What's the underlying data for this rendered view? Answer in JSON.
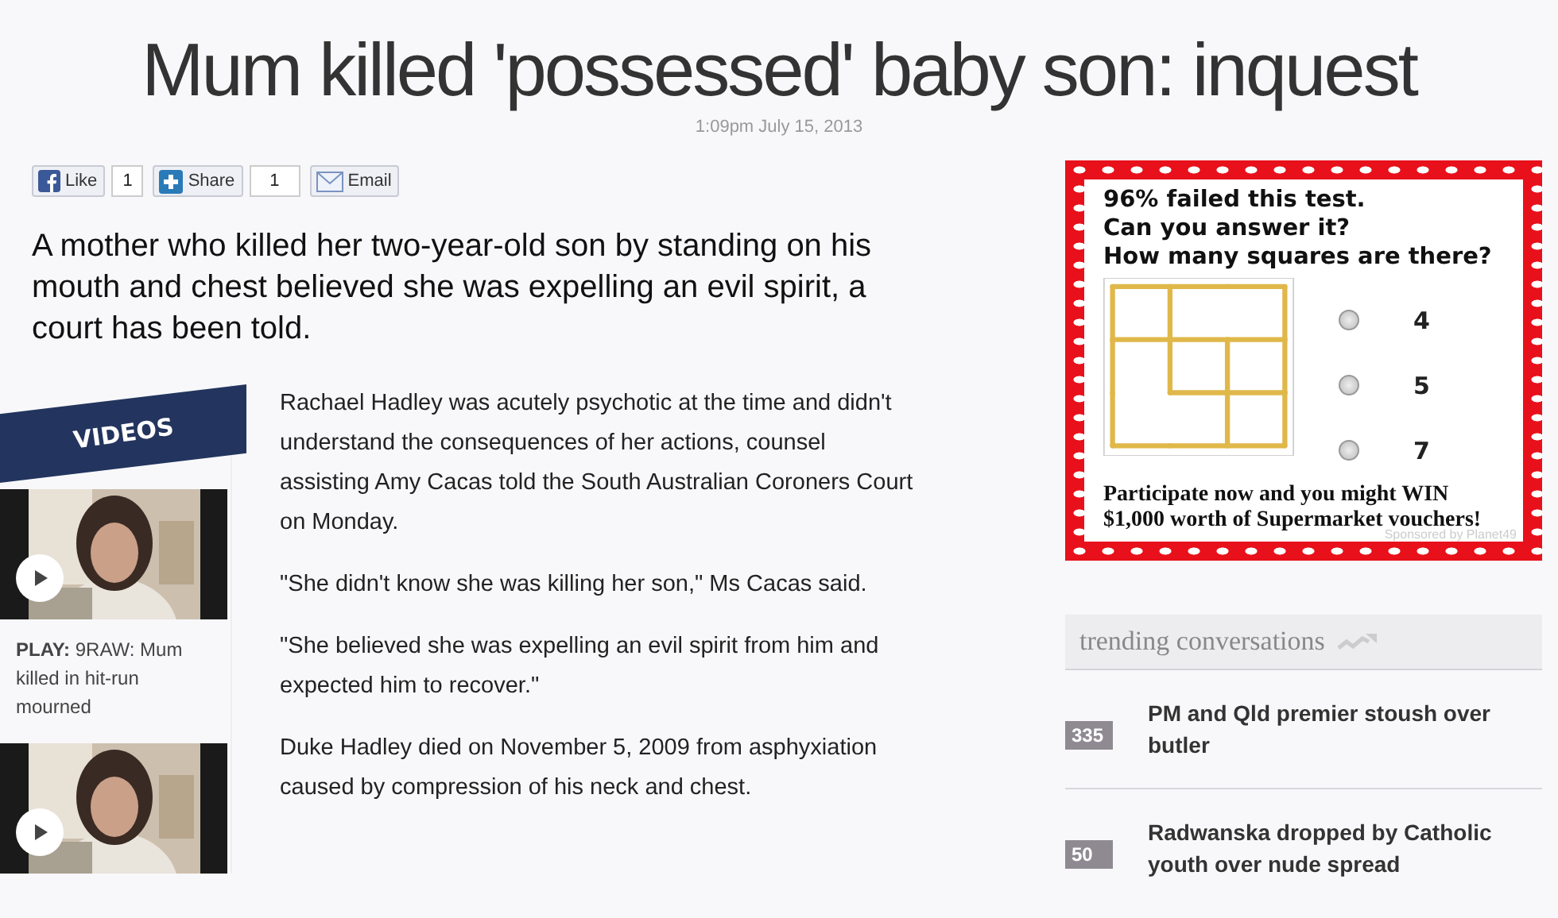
{
  "headline": "Mum killed 'possessed' baby son: inquest",
  "timestamp": "1:09pm July 15, 2013",
  "share_bar": {
    "like": {
      "label": "Like",
      "count": "1"
    },
    "share": {
      "label": "Share",
      "count": "1"
    },
    "email": {
      "label": "Email"
    }
  },
  "lead": "A mother who killed her two-year-old son by standing on his mouth and chest believed she was expelling an evil spirit, a court has been told.",
  "body": [
    "Rachael Hadley was acutely psychotic at the time and didn't understand the consequences of her actions, counsel assisting Amy Cacas told the South Australian Coroners Court on Monday.",
    "\"She didn't know she was killing her son,\" Ms Cacas said.",
    "\"She believed she was expelling an evil spirit from him and expected him to recover.\"",
    "Duke Hadley died on November 5, 2009 from asphyxiation caused by compression of his neck and chest."
  ],
  "videos": {
    "heading": "VIDEOS",
    "items": [
      {
        "kind": "picture",
        "caption": "**PLAY:** 9RAW: Mum killed in hit-run mourned"
      },
      {
        "kind": "picture"
      }
    ]
  },
  "ad": {
    "lines": [
      "96% failed this test.",
      "Can you answer it?",
      "How many squares are there?"
    ],
    "options": [
      {
        "label": "4",
        "selected": false
      },
      {
        "label": "5",
        "selected": false
      },
      {
        "label": "7",
        "selected": false
      }
    ],
    "footer": [
      "Participate now and you might WIN",
      "$1,000 worth of Supermarket vouchers!"
    ],
    "sponsor": "Sponsored by Planet49"
  },
  "trending": {
    "heading": "trending conversations",
    "items": [
      {
        "count": "335",
        "title": "PM and Qld premier stoush over butler"
      },
      {
        "count": "50",
        "title": "Radwanska dropped by Catholic youth over nude spread"
      }
    ]
  }
}
